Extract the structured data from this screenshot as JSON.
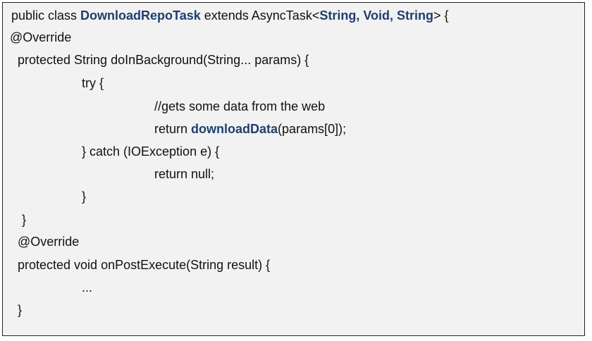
{
  "colors": {
    "background": "#f2f2f2",
    "border": "#222222",
    "text": "#111111",
    "highlight": "#1f3f6f"
  },
  "code": {
    "l1_a": "public class ",
    "l1_class": "DownloadRepoTask",
    "l1_b": " extends AsyncTask<",
    "l1_types": "String, Void, String",
    "l1_c": "> {",
    "l2": "@Override",
    "l3": "protected String doInBackground(String... params) {",
    "l4": "try {",
    "l5": "//gets some data from the web",
    "l6_a": "return ",
    "l6_method": "downloadData",
    "l6_b": "(params[0]);",
    "l7": "} catch (IOException e) {",
    "l8": "return null;",
    "l9": "}",
    "l10": "}",
    "l11": "@Override",
    "l12": "protected void onPostExecute(String result) {",
    "l13": "...",
    "l14": "}"
  }
}
